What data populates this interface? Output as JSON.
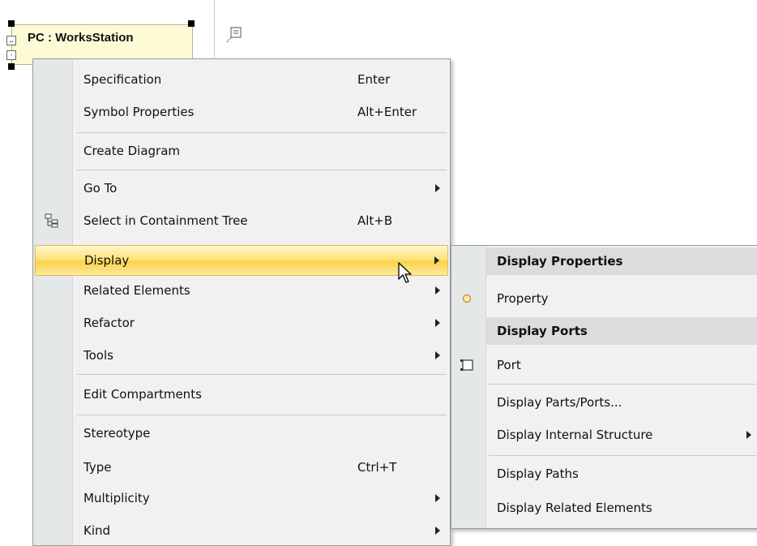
{
  "diagram": {
    "part_title": "PC : WorksStation"
  },
  "context_menu": {
    "items": [
      {
        "label": "Specification",
        "shortcut": "Enter"
      },
      {
        "label": "Symbol Properties",
        "shortcut": "Alt+Enter"
      },
      {
        "label": "Create Diagram"
      },
      {
        "label": "Go To",
        "submenu": true
      },
      {
        "label": "Select in Containment Tree",
        "shortcut": "Alt+B",
        "icon": "containment-tree-icon"
      },
      {
        "label": "Display",
        "submenu": true,
        "highlighted": true
      },
      {
        "label": "Related Elements",
        "submenu": true
      },
      {
        "label": "Refactor",
        "submenu": true
      },
      {
        "label": "Tools",
        "submenu": true
      },
      {
        "label": "Edit Compartments"
      },
      {
        "label": "Stereotype"
      },
      {
        "label": "Type",
        "shortcut": "Ctrl+T"
      },
      {
        "label": "Multiplicity",
        "submenu": true
      },
      {
        "label": "Kind",
        "submenu": true
      }
    ]
  },
  "display_submenu": {
    "display_properties_header": "Display Properties",
    "property_label": "Property",
    "display_ports_header": "Display Ports",
    "port_label": "Port",
    "display_parts_ports_label": "Display Parts/Ports...",
    "display_internal_structure_label": "Display Internal Structure",
    "display_paths_label": "Display Paths",
    "display_related_elements_label": "Display Related Elements"
  },
  "colors": {
    "highlight": "#fbd24b",
    "menu_bg": "#f1f1f1",
    "gutter": "#e4e8e9",
    "part_fill": "#fdfbd6"
  }
}
